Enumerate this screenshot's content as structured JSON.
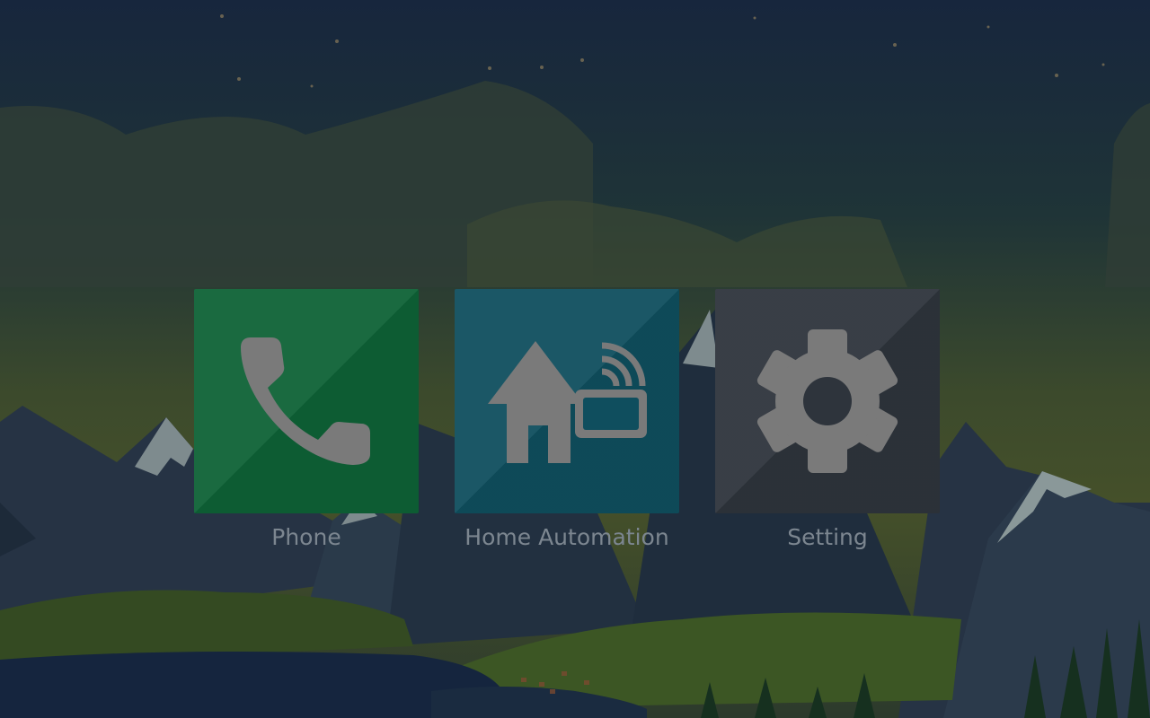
{
  "colors": {
    "phone_tile": "#0e6236",
    "home_tile": "#0f4e5e",
    "settings_tile": "#2e343c",
    "icon_fill": "#7a7a7a",
    "label_text": "#7c8690"
  },
  "apps": [
    {
      "label": "Phone",
      "icon": "phone-icon"
    },
    {
      "label": "Home Automation",
      "icon": "home-automation-icon"
    },
    {
      "label": "Setting",
      "icon": "gear-icon"
    }
  ]
}
